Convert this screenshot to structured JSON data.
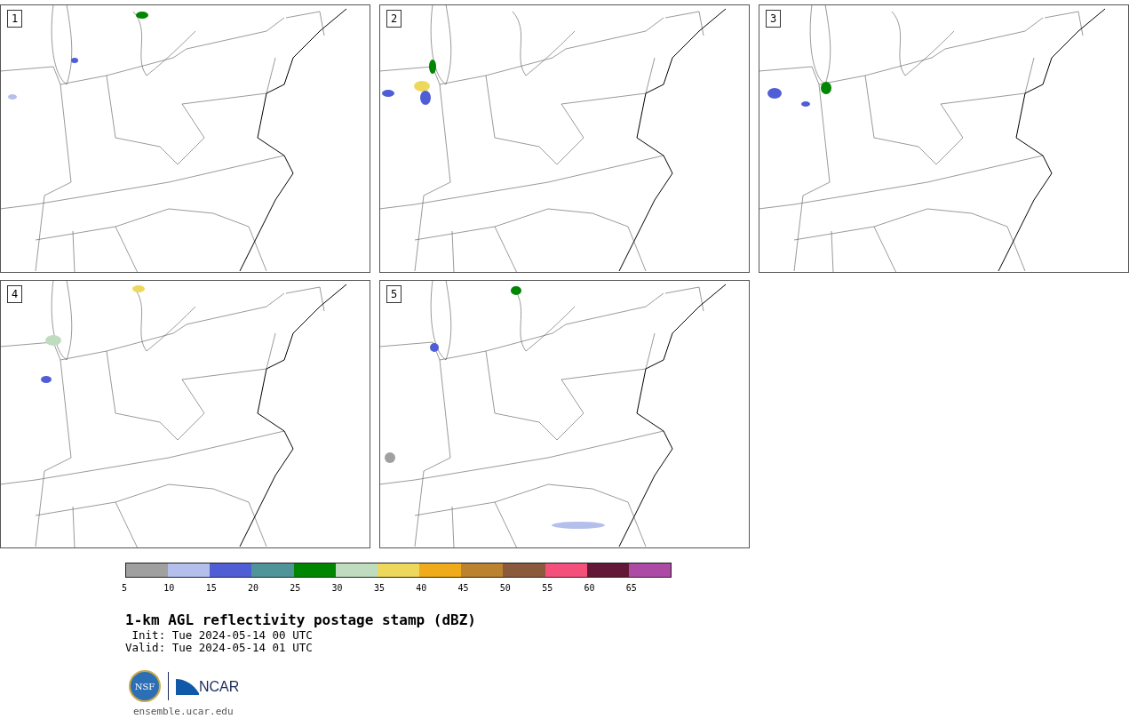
{
  "panels": [
    {
      "label": "1"
    },
    {
      "label": "2"
    },
    {
      "label": "3"
    },
    {
      "label": "4"
    },
    {
      "label": "5"
    }
  ],
  "colorbar": {
    "segments": [
      {
        "color": "#a0a0a0"
      },
      {
        "color": "#b4bfec"
      },
      {
        "color": "#505ed6"
      },
      {
        "color": "#4e9499"
      },
      {
        "color": "#008600"
      },
      {
        "color": "#bfdcbe"
      },
      {
        "color": "#eed85c"
      },
      {
        "color": "#efab19"
      },
      {
        "color": "#bb822f"
      },
      {
        "color": "#8b5a3d"
      },
      {
        "color": "#f4507c"
      },
      {
        "color": "#621836"
      },
      {
        "color": "#ac4aa5"
      }
    ],
    "ticks": [
      "5",
      "10",
      "15",
      "20",
      "25",
      "30",
      "35",
      "40",
      "45",
      "50",
      "55",
      "60",
      "65"
    ]
  },
  "title": "1-km AGL reflectivity postage stamp (dBZ)",
  "init": " Init: Tue 2024-05-14 00 UTC",
  "valid": "Valid: Tue 2024-05-14 01 UTC",
  "logos": {
    "nsf": "NSF",
    "ncar": "NCAR"
  },
  "footer": "ensemble.ucar.edu"
}
